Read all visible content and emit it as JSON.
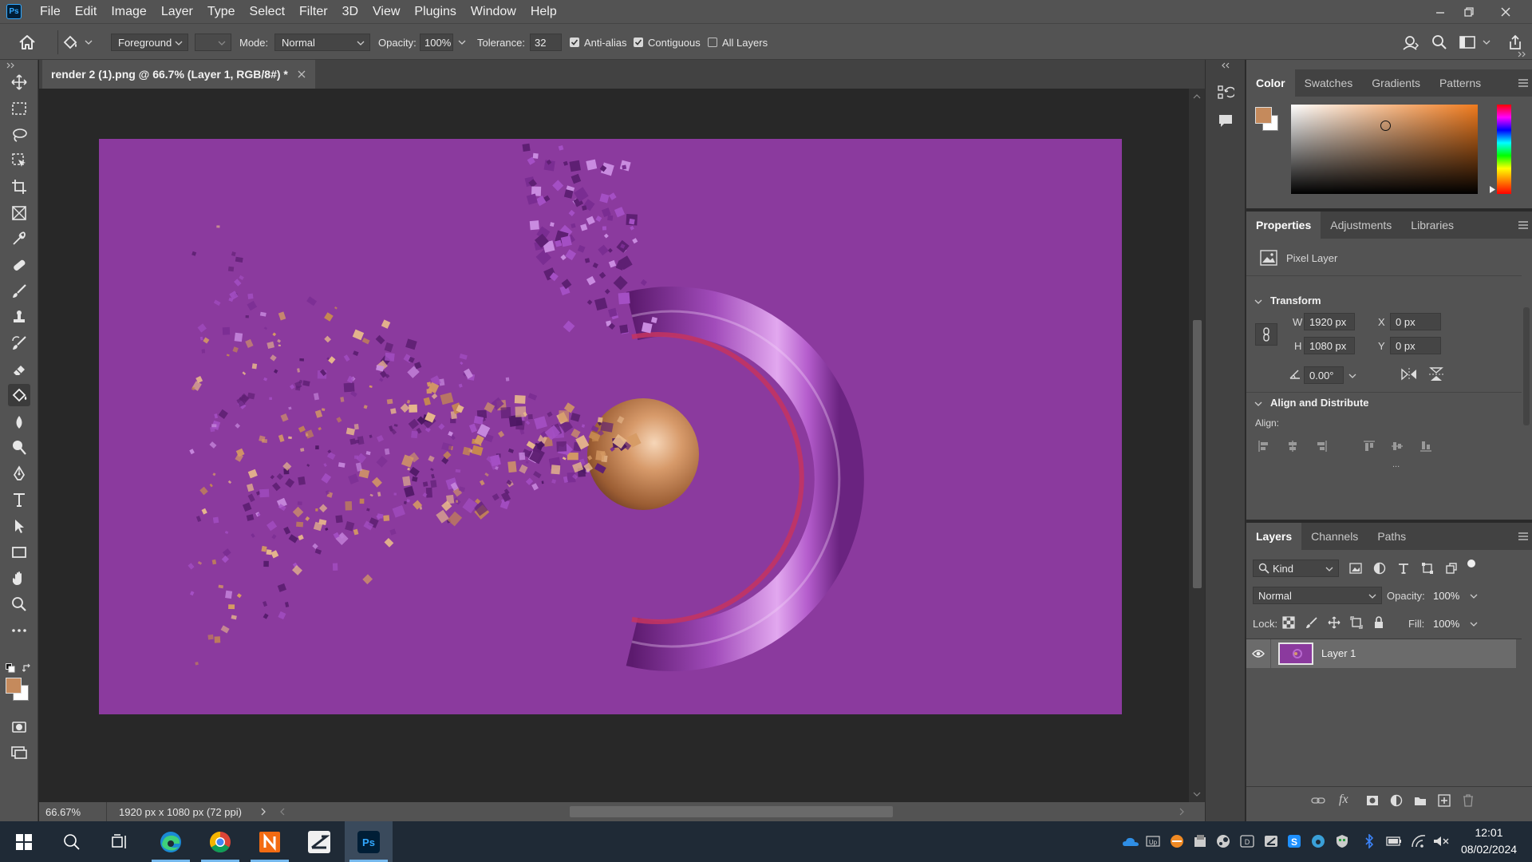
{
  "app": {
    "logo": "Ps",
    "menu": [
      "File",
      "Edit",
      "Image",
      "Layer",
      "Type",
      "Select",
      "Filter",
      "3D",
      "View",
      "Plugins",
      "Window",
      "Help"
    ]
  },
  "options": {
    "fill_source": "Foreground",
    "mode_label": "Mode:",
    "mode_value": "Normal",
    "opacity_label": "Opacity:",
    "opacity_value": "100%",
    "tolerance_label": "Tolerance:",
    "tolerance_value": "32",
    "anti_alias_label": "Anti-alias",
    "anti_alias_checked": true,
    "contiguous_label": "Contiguous",
    "contiguous_checked": true,
    "all_layers_label": "All Layers",
    "all_layers_checked": false
  },
  "document": {
    "tab_title": "render 2 (1).png @ 66.7% (Layer 1, RGB/8#) *",
    "canvas_color": "#8b3a9e"
  },
  "status": {
    "zoom": "66.67%",
    "doc_info": "1920 px x 1080 px (72 ppi)"
  },
  "colors": {
    "foreground": "#c58a5c",
    "background": "#ffffff",
    "picker_hue": "#f07b1e"
  },
  "color_panel": {
    "tabs": [
      "Color",
      "Swatches",
      "Gradients",
      "Patterns"
    ],
    "active_tab": "Color"
  },
  "properties_panel": {
    "tabs": [
      "Properties",
      "Adjustments",
      "Libraries"
    ],
    "active_tab": "Properties",
    "layer_kind": "Pixel Layer",
    "transform_title": "Transform",
    "w_label": "W",
    "w_value": "1920 px",
    "h_label": "H",
    "h_value": "1080 px",
    "x_label": "X",
    "x_value": "0 px",
    "y_label": "Y",
    "y_value": "0 px",
    "angle_value": "0.00°",
    "align_title": "Align and Distribute",
    "align_label": "Align:",
    "more": "..."
  },
  "layers_panel": {
    "tabs": [
      "Layers",
      "Channels",
      "Paths"
    ],
    "active_tab": "Layers",
    "filter_kind": "Kind",
    "blend_mode": "Normal",
    "opacity_label": "Opacity:",
    "opacity_value": "100%",
    "lock_label": "Lock:",
    "fill_label": "Fill:",
    "fill_value": "100%",
    "layers": [
      {
        "name": "Layer 1",
        "visible": true
      }
    ]
  },
  "taskbar": {
    "time": "12:01",
    "date": "08/02/2024"
  }
}
